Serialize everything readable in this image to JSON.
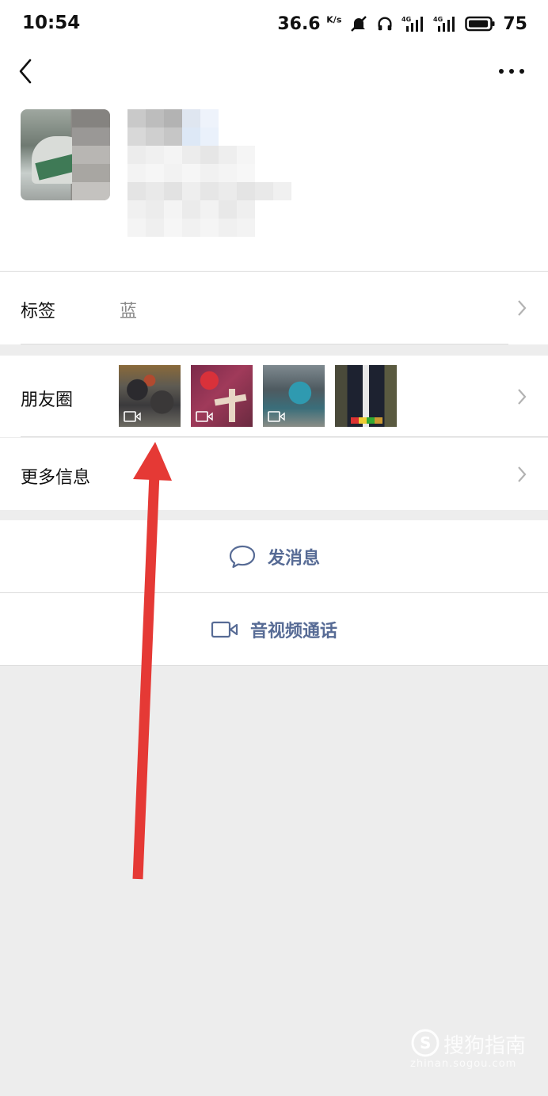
{
  "status_bar": {
    "time": "10:54",
    "speed_value": "36.6",
    "speed_unit": "K/s",
    "battery": "75"
  },
  "profile": {
    "name": "",
    "icons": {
      "back": "chevron-left-icon",
      "more": "more-dots-icon"
    }
  },
  "tags_row": {
    "label": "标签",
    "value": "蓝"
  },
  "moments_row": {
    "label": "朋友圈",
    "thumbnails": [
      {
        "name": "moments-thumb-1",
        "has_video": true
      },
      {
        "name": "moments-thumb-2",
        "has_video": true
      },
      {
        "name": "moments-thumb-3",
        "has_video": true
      },
      {
        "name": "moments-thumb-4",
        "has_video": false
      }
    ]
  },
  "more_info_row": {
    "label": "更多信息"
  },
  "actions": {
    "message": {
      "label": "发消息",
      "icon": "chat-bubble-icon"
    },
    "call": {
      "label": "音视频通话",
      "icon": "video-camera-icon"
    }
  },
  "annotation": {
    "color": "#e53935"
  },
  "watermark": {
    "text": "搜狗指南",
    "sub": "zhinan.sogou.com"
  },
  "colors": {
    "link": "#576b95",
    "background": "#ededed"
  }
}
